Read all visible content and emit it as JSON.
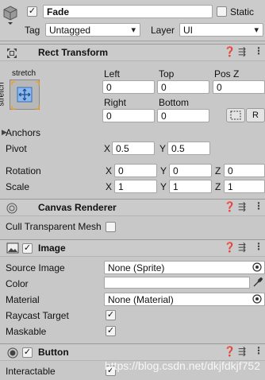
{
  "gameobject": {
    "active": true,
    "name": "Fade",
    "static_label": "Static",
    "static_checked": false,
    "tag_label": "Tag",
    "tag_value": "Untagged",
    "layer_label": "Layer",
    "layer_value": "UI"
  },
  "rect_transform": {
    "title": "Rect Transform",
    "anchor_preset_top": "stretch",
    "anchor_preset_side": "stretch",
    "left_label": "Left",
    "top_label": "Top",
    "posz_label": "Pos Z",
    "left": "0",
    "top": "0",
    "posz": "0",
    "right_label": "Right",
    "bottom_label": "Bottom",
    "right": "0",
    "bottom": "0",
    "r_button": "R",
    "anchors_label": "Anchors",
    "pivot_label": "Pivot",
    "pivot_x_label": "X",
    "pivot_x": "0.5",
    "pivot_y_label": "Y",
    "pivot_y": "0.5",
    "rotation_label": "Rotation",
    "rotation": {
      "x_label": "X",
      "x": "0",
      "y_label": "Y",
      "y": "0",
      "z_label": "Z",
      "z": "0"
    },
    "scale_label": "Scale",
    "scale": {
      "x_label": "X",
      "x": "1",
      "y_label": "Y",
      "y": "1",
      "z_label": "Z",
      "z": "1"
    }
  },
  "canvas_renderer": {
    "title": "Canvas Renderer",
    "cull_label": "Cull Transparent Mesh",
    "cull_checked": false
  },
  "image": {
    "title": "Image",
    "enabled": true,
    "source_image_label": "Source Image",
    "source_image": "None (Sprite)",
    "color_label": "Color",
    "color_value": "#ffffff",
    "material_label": "Material",
    "material": "None (Material)",
    "raycast_label": "Raycast Target",
    "raycast_checked": true,
    "maskable_label": "Maskable",
    "maskable_checked": true
  },
  "button": {
    "title": "Button",
    "enabled": true,
    "interactable_label": "Interactable",
    "interactable_checked": true
  },
  "watermark": "https://blog.csdn.net/dkjfdkjf752"
}
